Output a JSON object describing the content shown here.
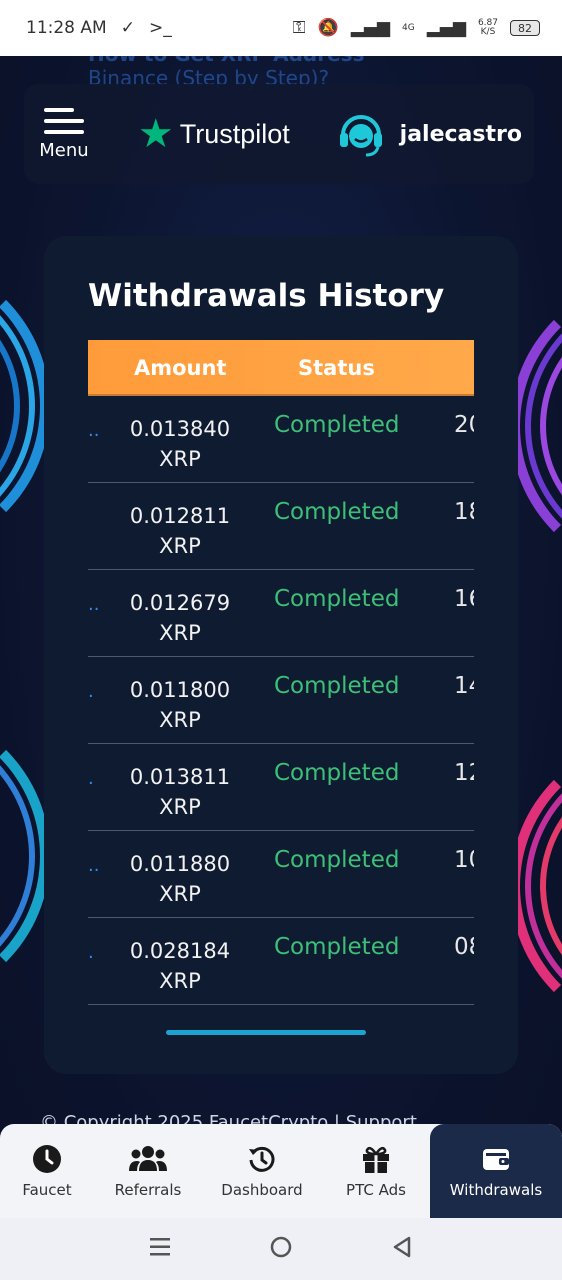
{
  "status_bar": {
    "time": "11:28 AM",
    "network_speed": "6.87",
    "network_speed_unit": "K/S",
    "network_type": "4G",
    "battery": "82"
  },
  "top_fade_text": {
    "line1": "How to Get XRP Address",
    "line2": "Binance (Step by Step)?"
  },
  "header": {
    "menu_label": "Menu",
    "trustpilot_label": "Trustpilot",
    "username": "jalecastro"
  },
  "card": {
    "title": "Withdrawals History",
    "columns": [
      "Amount",
      "Status"
    ],
    "rows": [
      {
        "dots": "..",
        "amount": "0.013840",
        "unit": "XRP",
        "status": "Completed",
        "date": "20"
      },
      {
        "dots": "",
        "amount": "0.012811",
        "unit": "XRP",
        "status": "Completed",
        "date": "18"
      },
      {
        "dots": "..",
        "amount": "0.012679",
        "unit": "XRP",
        "status": "Completed",
        "date": "16"
      },
      {
        "dots": ".",
        "amount": "0.011800",
        "unit": "XRP",
        "status": "Completed",
        "date": "14"
      },
      {
        "dots": ".",
        "amount": "0.013811",
        "unit": "XRP",
        "status": "Completed",
        "date": "12"
      },
      {
        "dots": "..",
        "amount": "0.011880",
        "unit": "XRP",
        "status": "Completed",
        "date": "10"
      },
      {
        "dots": ".",
        "amount": "0.028184",
        "unit": "XRP",
        "status": "Completed",
        "date": "08"
      }
    ]
  },
  "footer_peek": "© Copyright 2025 FaucetCrypto | Support",
  "bottom_nav": {
    "items": [
      {
        "label": "Faucet",
        "icon": "clock-icon"
      },
      {
        "label": "Referrals",
        "icon": "users-icon"
      },
      {
        "label": "Dashboard",
        "icon": "history-icon"
      },
      {
        "label": "PTC Ads",
        "icon": "gift-icon"
      },
      {
        "label": "Withdrawals",
        "icon": "wallet-icon",
        "active": true
      }
    ]
  },
  "colors": {
    "accent_orange": "#ffa040",
    "status_green": "#3dbf77",
    "trustpilot_green": "#00b67a",
    "support_teal": "#1fc8d8"
  }
}
